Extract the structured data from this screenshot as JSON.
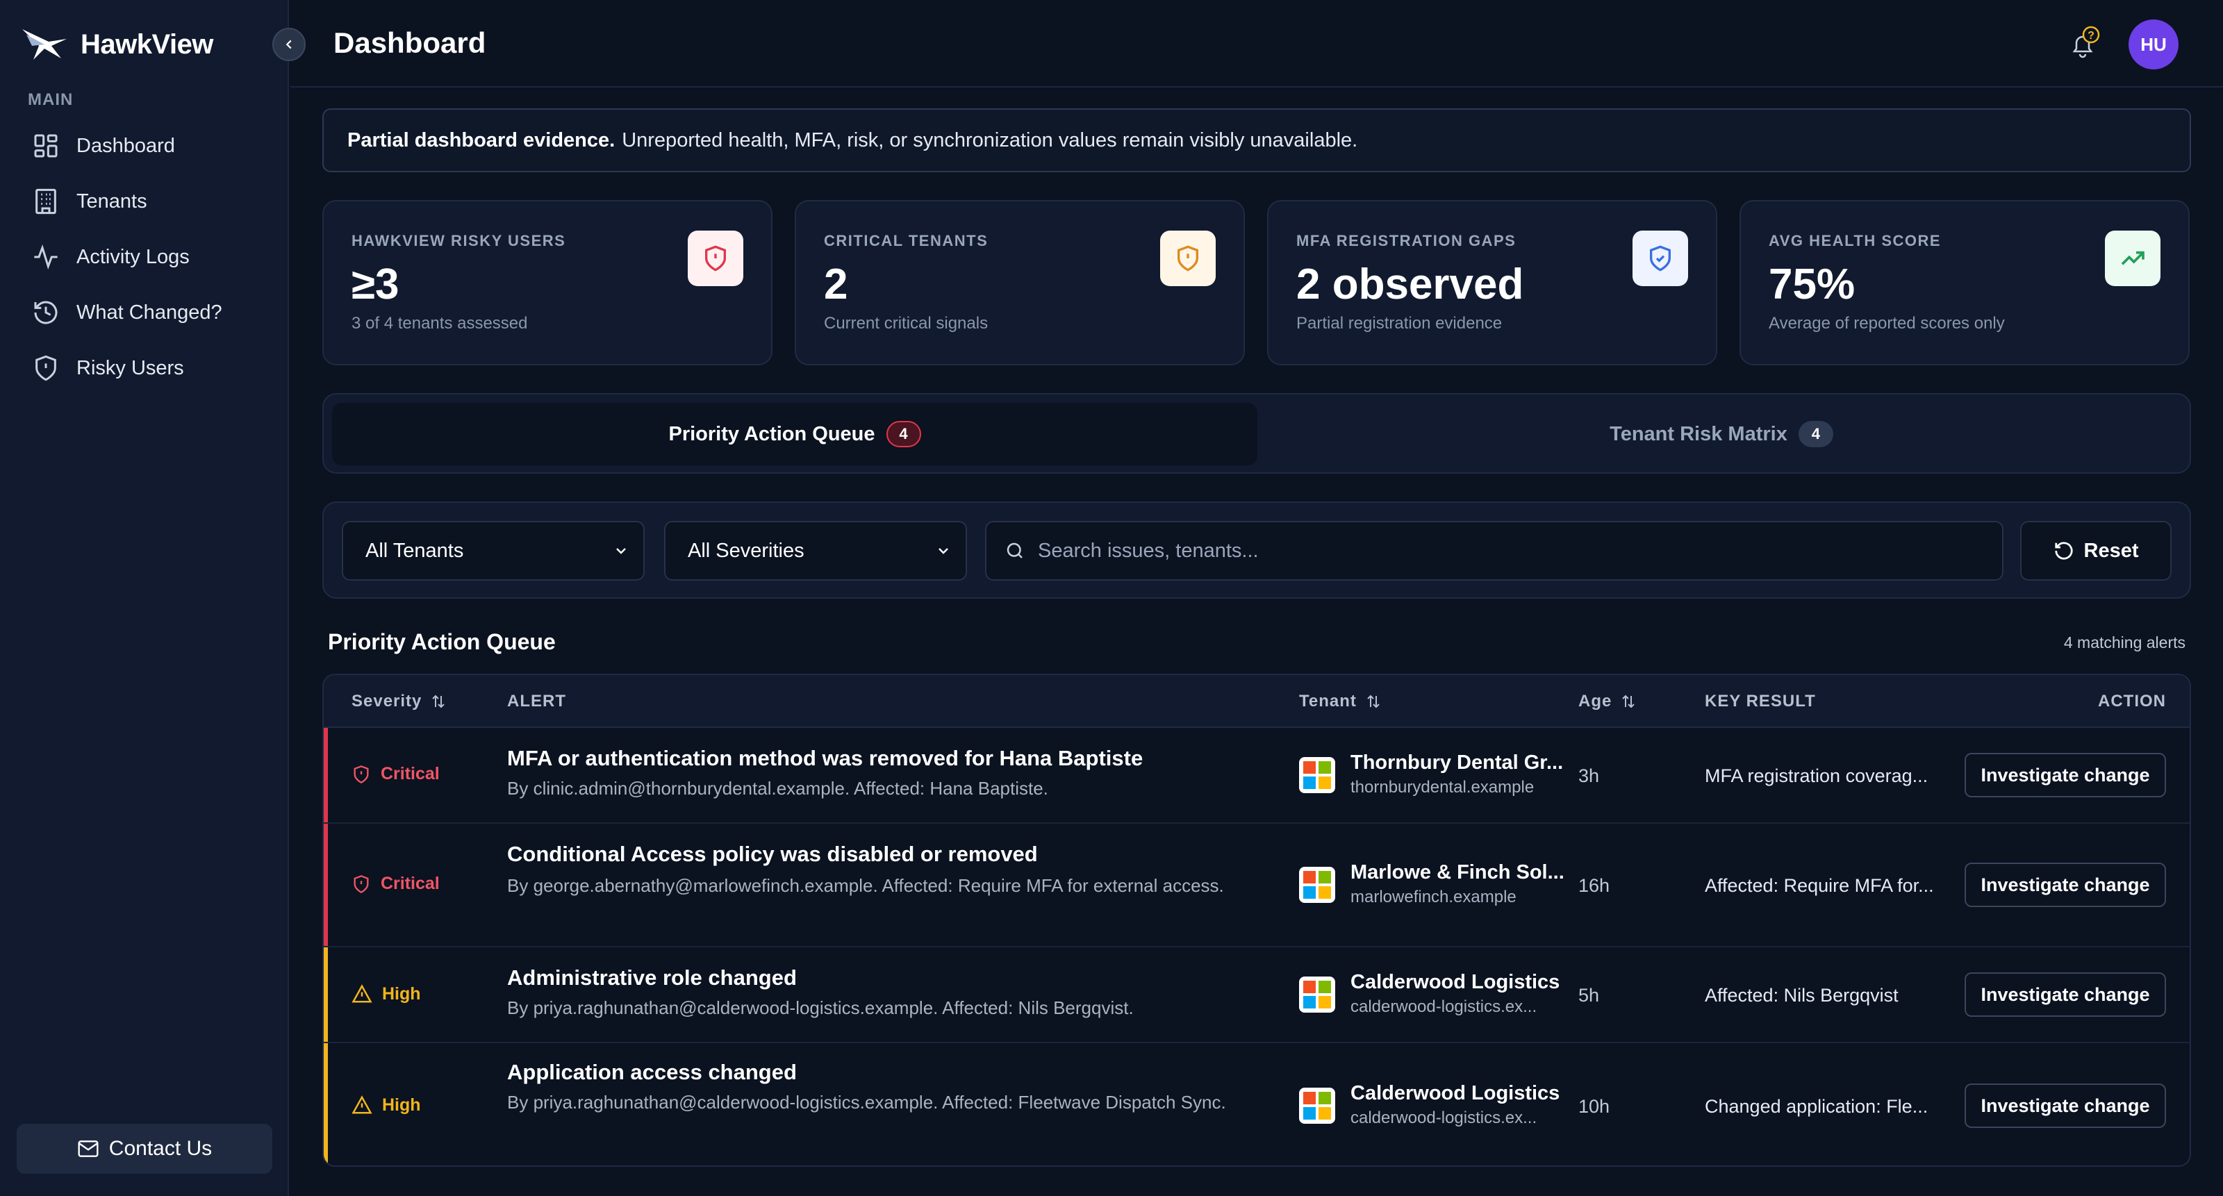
{
  "app": {
    "name": "HawkView"
  },
  "sidebar": {
    "section": "MAIN",
    "items": [
      {
        "label": "Dashboard",
        "icon": "dashboard-icon"
      },
      {
        "label": "Tenants",
        "icon": "building-icon"
      },
      {
        "label": "Activity Logs",
        "icon": "activity-icon"
      },
      {
        "label": "What Changed?",
        "icon": "history-icon"
      },
      {
        "label": "Risky Users",
        "icon": "shield-icon"
      }
    ],
    "contact_label": "Contact Us"
  },
  "header": {
    "title": "Dashboard",
    "avatar_initials": "HU"
  },
  "banner": {
    "bold": "Partial dashboard evidence.",
    "text": "Unreported health, MFA, risk, or synchronization values remain visibly unavailable."
  },
  "stats": [
    {
      "label": "HAWKVIEW RISKY USERS",
      "value": "≥3",
      "sub": "3 of 4 tenants assessed",
      "icon": "shield-alert-icon",
      "color": "#e0364c"
    },
    {
      "label": "CRITICAL TENANTS",
      "value": "2",
      "sub": "Current critical signals",
      "icon": "shield-alert-icon",
      "color": "#e08a1e"
    },
    {
      "label": "MFA REGISTRATION GAPS",
      "value": "2 observed",
      "sub": "Partial registration evidence",
      "icon": "shield-check-icon",
      "color": "#3b6fe0"
    },
    {
      "label": "AVG HEALTH SCORE",
      "value": "75%",
      "sub": "Average of reported scores only",
      "icon": "trending-up-icon",
      "color": "#22a05a"
    }
  ],
  "tabs": [
    {
      "label": "Priority Action Queue",
      "count": "4"
    },
    {
      "label": "Tenant Risk Matrix",
      "count": "4"
    }
  ],
  "filters": {
    "tenant": "All Tenants",
    "severity": "All Severities",
    "search_placeholder": "Search issues, tenants...",
    "reset_label": "Reset"
  },
  "queue": {
    "title": "Priority Action Queue",
    "match_count": "4 matching alerts",
    "columns": {
      "severity": "Severity",
      "alert": "ALERT",
      "tenant": "Tenant",
      "age": "Age",
      "key_result": "KEY RESULT",
      "action": "ACTION"
    },
    "rows": [
      {
        "severity": "Critical",
        "severity_color": "#f05566",
        "title": "MFA or authentication method was removed for Hana Baptiste",
        "desc": "By clinic.admin@thornburydental.example. Affected: Hana Baptiste.",
        "tenant": "Thornbury Dental Gr...",
        "domain": "thornburydental.example",
        "age": "3h",
        "key_result": "MFA registration coverag...",
        "action": "Investigate change"
      },
      {
        "severity": "Critical",
        "severity_color": "#f05566",
        "title": "Conditional Access policy was disabled or removed",
        "desc": "By george.abernathy@marlowefinch.example. Affected: Require MFA for external access.",
        "tenant": "Marlowe & Finch Sol...",
        "domain": "marlowefinch.example",
        "age": "16h",
        "key_result": "Affected: Require MFA for...",
        "action": "Investigate change"
      },
      {
        "severity": "High",
        "severity_color": "#f2b51c",
        "title": "Administrative role changed",
        "desc": "By priya.raghunathan@calderwood-logistics.example. Affected: Nils Bergqvist.",
        "tenant": "Calderwood Logistics",
        "domain": "calderwood-logistics.ex...",
        "age": "5h",
        "key_result": "Affected: Nils Bergqvist",
        "action": "Investigate change"
      },
      {
        "severity": "High",
        "severity_color": "#f2b51c",
        "title": "Application access changed",
        "desc": "By priya.raghunathan@calderwood-logistics.example. Affected: Fleetwave Dispatch Sync.",
        "tenant": "Calderwood Logistics",
        "domain": "calderwood-logistics.ex...",
        "age": "10h",
        "key_result": "Changed application: Fle...",
        "action": "Investigate change"
      }
    ]
  }
}
